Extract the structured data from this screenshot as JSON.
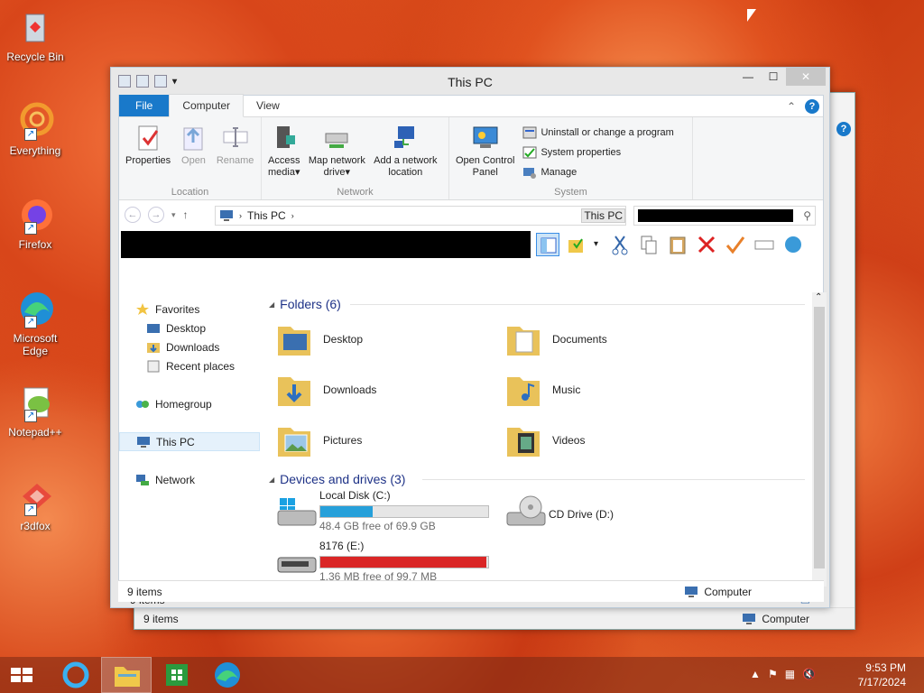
{
  "desktop": {
    "icons": [
      {
        "label": "Recycle Bin"
      },
      {
        "label": "Everything"
      },
      {
        "label": "Firefox"
      },
      {
        "label": "Microsoft Edge"
      },
      {
        "label": "Notepad++"
      },
      {
        "label": "r3dfox"
      }
    ]
  },
  "back_window": {
    "status_items": "9 items",
    "status_location": "Computer"
  },
  "window": {
    "title": "This PC",
    "tabs": {
      "file": "File",
      "computer": "Computer",
      "view": "View"
    },
    "ribbon": {
      "location": {
        "label": "Location",
        "properties": "Properties",
        "open": "Open",
        "rename": "Rename"
      },
      "network": {
        "label": "Network",
        "access_media_1": "Access",
        "access_media_2": "media",
        "map_drive_1": "Map network",
        "map_drive_2": "drive",
        "add_location_1": "Add a network",
        "add_location_2": "location"
      },
      "system": {
        "label": "System",
        "open_cp_1": "Open Control",
        "open_cp_2": "Panel",
        "uninstall": "Uninstall or change a program",
        "sys_props": "System properties",
        "manage": "Manage"
      }
    },
    "address": {
      "crumb": "This PC",
      "search_overlay": "This PC"
    },
    "nav": {
      "favorites": "Favorites",
      "desktop": "Desktop",
      "downloads": "Downloads",
      "recent": "Recent places",
      "homegroup": "Homegroup",
      "thispc": "This PC",
      "network": "Network"
    },
    "folders_header": "Folders (6)",
    "folders": [
      {
        "name": "Desktop"
      },
      {
        "name": "Documents"
      },
      {
        "name": "Downloads"
      },
      {
        "name": "Music"
      },
      {
        "name": "Pictures"
      },
      {
        "name": "Videos"
      }
    ],
    "devices_header": "Devices and drives (3)",
    "drives": [
      {
        "name": "Local Disk (C:)",
        "free": "48.4 GB free of 69.9 GB",
        "used_fraction": 0.31,
        "color": "#26a0da"
      },
      {
        "name": "CD Drive (D:)"
      },
      {
        "name": "8176 (E:)",
        "free": "1.36 MB free of 99.7 MB",
        "used_fraction": 0.99,
        "color": "#da2626"
      }
    ],
    "status_inner": "9 items",
    "status_items": "9 items",
    "status_location": "Computer"
  },
  "taskbar": {
    "time": "9:53 PM",
    "date": "7/17/2024"
  }
}
